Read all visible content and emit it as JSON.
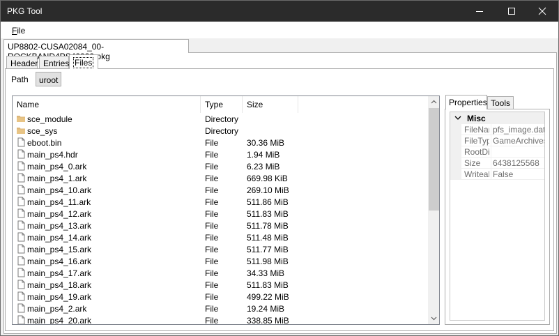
{
  "window": {
    "title": "PKG Tool"
  },
  "menu": {
    "file_label": "File"
  },
  "file_tab": {
    "label": "UP8802-CUSA02084_00-ROCKBAND4PS40000.pkg"
  },
  "sub_tabs": [
    {
      "label": "Header"
    },
    {
      "label": "Entries"
    },
    {
      "label": "Files"
    }
  ],
  "path": {
    "label": "Path",
    "button_label": "uroot"
  },
  "columns": {
    "name": "Name",
    "type": "Type",
    "size": "Size"
  },
  "files": [
    {
      "name": "sce_module",
      "type": "Directory",
      "size": "",
      "icon": "folder-icon"
    },
    {
      "name": "sce_sys",
      "type": "Directory",
      "size": "",
      "icon": "folder-icon"
    },
    {
      "name": "eboot.bin",
      "type": "File",
      "size": "30.36 MiB",
      "icon": "file-icon"
    },
    {
      "name": "main_ps4.hdr",
      "type": "File",
      "size": "1.94 MiB",
      "icon": "file-icon"
    },
    {
      "name": "main_ps4_0.ark",
      "type": "File",
      "size": "6.23 MiB",
      "icon": "file-icon"
    },
    {
      "name": "main_ps4_1.ark",
      "type": "File",
      "size": "669.98 KiB",
      "icon": "file-icon"
    },
    {
      "name": "main_ps4_10.ark",
      "type": "File",
      "size": "269.10 MiB",
      "icon": "file-icon"
    },
    {
      "name": "main_ps4_11.ark",
      "type": "File",
      "size": "511.86 MiB",
      "icon": "file-icon"
    },
    {
      "name": "main_ps4_12.ark",
      "type": "File",
      "size": "511.83 MiB",
      "icon": "file-icon"
    },
    {
      "name": "main_ps4_13.ark",
      "type": "File",
      "size": "511.78 MiB",
      "icon": "file-icon"
    },
    {
      "name": "main_ps4_14.ark",
      "type": "File",
      "size": "511.48 MiB",
      "icon": "file-icon"
    },
    {
      "name": "main_ps4_15.ark",
      "type": "File",
      "size": "511.77 MiB",
      "icon": "file-icon"
    },
    {
      "name": "main_ps4_16.ark",
      "type": "File",
      "size": "511.98 MiB",
      "icon": "file-icon"
    },
    {
      "name": "main_ps4_17.ark",
      "type": "File",
      "size": "34.33 MiB",
      "icon": "file-icon"
    },
    {
      "name": "main_ps4_18.ark",
      "type": "File",
      "size": "511.83 MiB",
      "icon": "file-icon"
    },
    {
      "name": "main_ps4_19.ark",
      "type": "File",
      "size": "499.22 MiB",
      "icon": "file-icon"
    },
    {
      "name": "main_ps4_2.ark",
      "type": "File",
      "size": "19.24 MiB",
      "icon": "file-icon"
    },
    {
      "name": "main_ps4_20.ark",
      "type": "File",
      "size": "338.85 MiB",
      "icon": "file-icon"
    }
  ],
  "side_tabs": [
    {
      "label": "Properties"
    },
    {
      "label": "Tools"
    }
  ],
  "properties": {
    "category": "Misc",
    "rows": [
      {
        "key": "FileName",
        "value": "pfs_image.dat"
      },
      {
        "key": "FileType",
        "value": "GameArchives.PFS.PFSImage"
      },
      {
        "key": "RootDirectory",
        "value": ""
      },
      {
        "key": "Size",
        "value": "6438125568"
      },
      {
        "key": "Writeable",
        "value": "False"
      }
    ]
  },
  "colors": {
    "titlebar": "#2b2b2b",
    "folder": "#dcb67a",
    "window_bg": "#f0f0f0",
    "border": "#adadad"
  }
}
